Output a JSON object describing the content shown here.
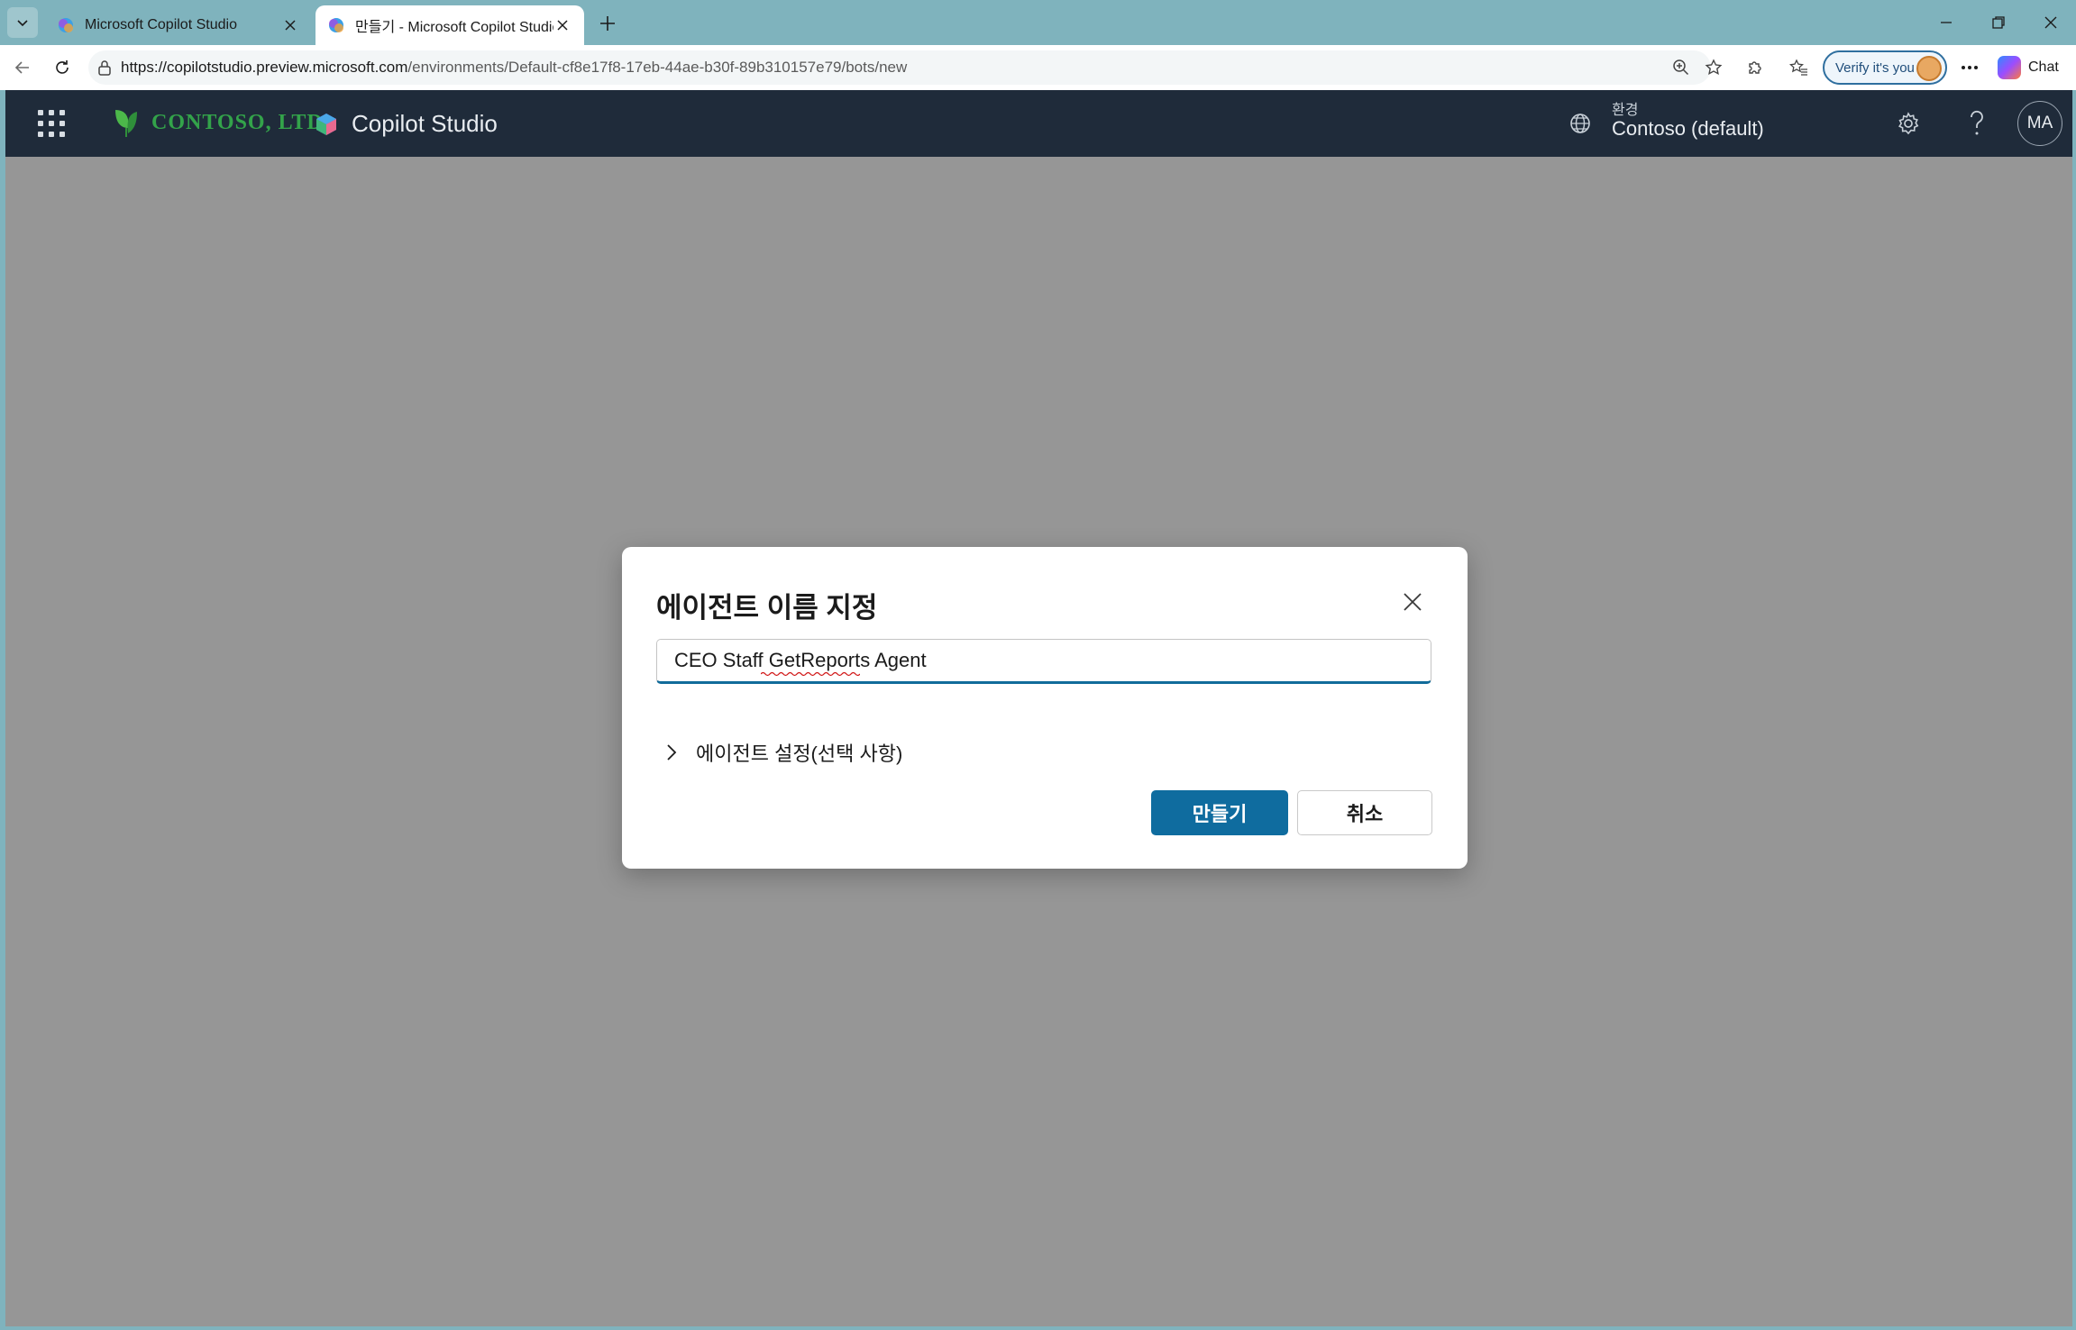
{
  "browser": {
    "tabs": [
      {
        "title": "Microsoft Copilot Studio",
        "active": false
      },
      {
        "title": "만들기 - Microsoft Copilot Studio",
        "active": true
      }
    ],
    "url_host": "https://copilotstudio.preview.microsoft.com",
    "url_path": "/environments/Default-cf8e17f8-17eb-44ae-b30f-89b310157e79/bots/new",
    "verify_label": "Verify it's you",
    "chat_label": "Chat"
  },
  "app": {
    "org_name": "CONTOSO, LTD.",
    "product_name": "Copilot Studio",
    "environment_label": "환경",
    "environment_name": "Contoso (default)",
    "avatar_initials": "MA",
    "colors": {
      "header_bg": "#1f2b3a",
      "primary": "#0f6c9f",
      "overlay": "#969696",
      "brand_green": "#33a34a"
    }
  },
  "dialog": {
    "title": "에이전트 이름 지정",
    "name_value": "CEO Staff GetReports Agent",
    "settings_expander": "에이전트 설정(선택 사항)",
    "create_label": "만들기",
    "cancel_label": "취소"
  }
}
